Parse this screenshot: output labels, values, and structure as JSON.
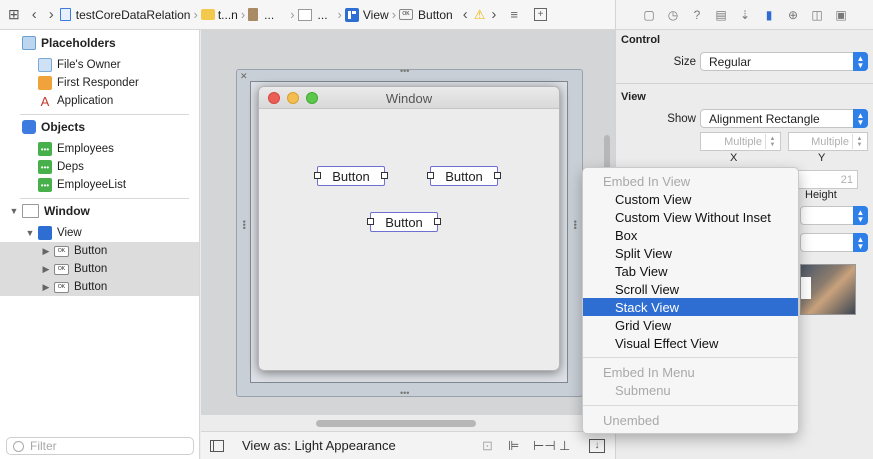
{
  "jumpbar": {
    "project": "testCoreDataRelation",
    "folder": "t...n",
    "file": "...",
    "item": "...",
    "view": "View",
    "button": "Button"
  },
  "navigator": {
    "placeholders_title": "Placeholders",
    "placeholders": [
      "File's Owner",
      "First Responder",
      "Application"
    ],
    "objects_title": "Objects",
    "objects": [
      "Employees",
      "Deps",
      "EmployeeList"
    ],
    "window": "Window",
    "view": "View",
    "buttons": [
      "Button",
      "Button",
      "Button"
    ],
    "ok_badge": "OK",
    "filter_placeholder": "Filter"
  },
  "canvas": {
    "window_title": "Window",
    "buttons": [
      "Button",
      "Button",
      "Button"
    ]
  },
  "bottom": {
    "view_as": "View as: Light Appearance"
  },
  "inspector": {
    "control_title": "Control",
    "size_label": "Size",
    "size_value": "Regular",
    "view_title": "View",
    "show_label": "Show",
    "show_value": "Alignment Rectangle",
    "x_placeholder": "Multiple",
    "y_placeholder": "Multiple",
    "x_label": "X",
    "y_label": "Y",
    "height_value": "21",
    "height_label": "Height"
  },
  "menu": {
    "header_embed_view": "Embed In View",
    "items": [
      "Custom View",
      "Custom View Without Inset",
      "Box",
      "Split View",
      "Tab View",
      "Scroll View",
      "Stack View",
      "Grid View",
      "Visual Effect View"
    ],
    "highlighted": "Stack View",
    "header_embed_menu": "Embed In Menu",
    "submenu": "Submenu",
    "unembed": "Unembed"
  },
  "colors": {
    "accent": "#2e6ed3",
    "close": "#ec5f56",
    "minimize": "#f4bd4f",
    "zoom": "#5cc84b"
  }
}
